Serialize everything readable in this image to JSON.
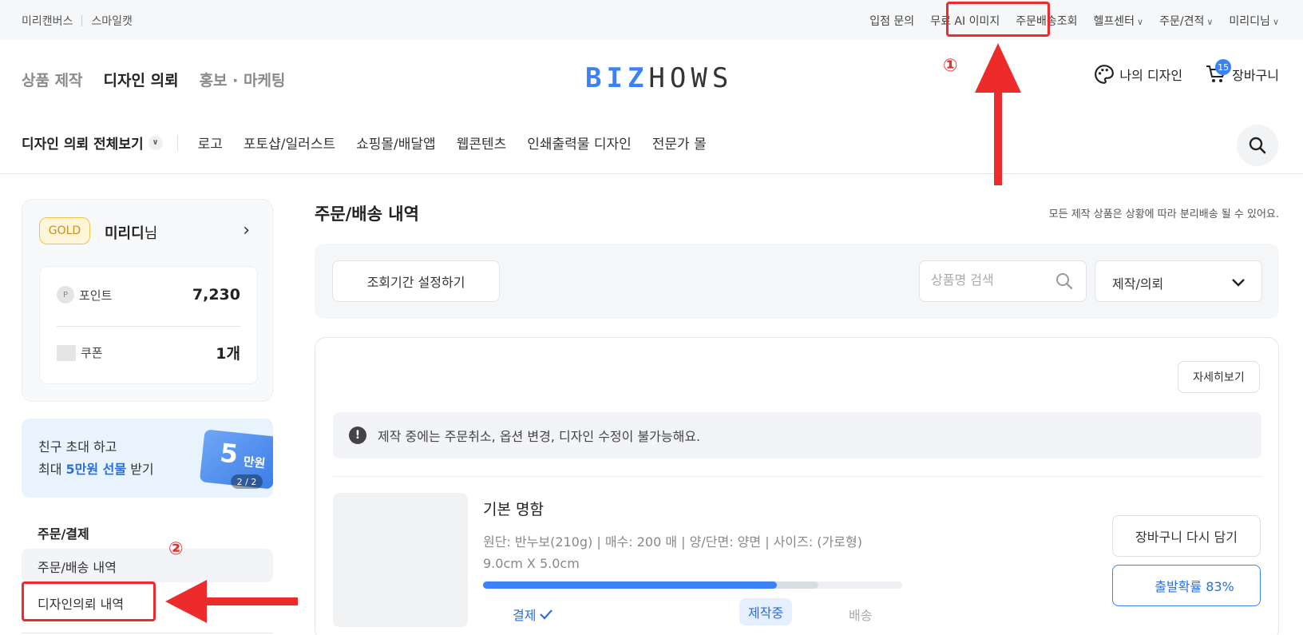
{
  "topbar": {
    "left_links": [
      "미리캔버스",
      "스마일캣"
    ],
    "right_links": [
      {
        "label": "입점 문의",
        "dropdown": false
      },
      {
        "label": "무료 AI 이미지",
        "dropdown": false
      },
      {
        "label": "주문배송조회",
        "dropdown": false
      },
      {
        "label": "헬프센터",
        "dropdown": true
      },
      {
        "label": "주문/견적",
        "dropdown": true
      },
      {
        "label": "미리디님",
        "dropdown": true
      }
    ]
  },
  "header": {
    "nav": [
      "상품 제작",
      "디자인 의뢰",
      "홍보 · 마케팅"
    ],
    "logo": {
      "part1": "BIZ",
      "part2": "HOWS"
    },
    "my_design": "나의 디자인",
    "cart": "장바구니",
    "cart_count": "15"
  },
  "category_bar": {
    "all_label": "디자인 의뢰 전체보기",
    "items": [
      "로고",
      "포토샵/일러스트",
      "쇼핑몰/배달앱",
      "웹콘텐츠",
      "인쇄출력물 디자인",
      "전문가 몰"
    ]
  },
  "profile": {
    "grade": "GOLD",
    "name": "미리디",
    "suffix": "님",
    "point_icon": "P",
    "point_label": "포인트",
    "point_value": "7,230",
    "coupon_label": "쿠폰",
    "coupon_value": "1개"
  },
  "invite": {
    "line1": "친구 초대 하고",
    "line2_prefix": "최대 ",
    "line2_highlight": "5만원 선물",
    "line2_suffix": " 받기",
    "ticket_number": "5",
    "ticket_unit": "만원",
    "pager": "2 / 2"
  },
  "sidebar_menu": {
    "heading": "주문/결제",
    "items": [
      "주문/배송 내역",
      "디자인의뢰 내역"
    ]
  },
  "main": {
    "title": "주문/배송 내역",
    "notice": "모든 제작 상품은 상황에 따라 분리배송 될 수 있어요.",
    "period_button": "조회기간 설정하기",
    "search_placeholder": "상품명 검색",
    "filter_selected": "제작/의뢰"
  },
  "order": {
    "detail_button": "자세히보기",
    "warning": "제작 중에는 주문취소, 옵션 변경, 디자인 수정이 불가능해요.",
    "product_name": "기본 명함",
    "spec_line1": "원단: 반누보(210g) | 매수: 200 매 | 양/단면: 양면 | 사이즈: (가로형)",
    "spec_line2": "9.0cm X 5.0cm",
    "steps": [
      "결제",
      "제작중",
      "배송"
    ],
    "progress_fraction": 0.7,
    "progress_secondary_fraction": 0.8,
    "recart_button": "장바구니 다시 담기",
    "probability_button": "출발확률 83%"
  },
  "annotations": {
    "marker1": "①",
    "marker2": "②",
    "color": "#ee2b2b"
  }
}
